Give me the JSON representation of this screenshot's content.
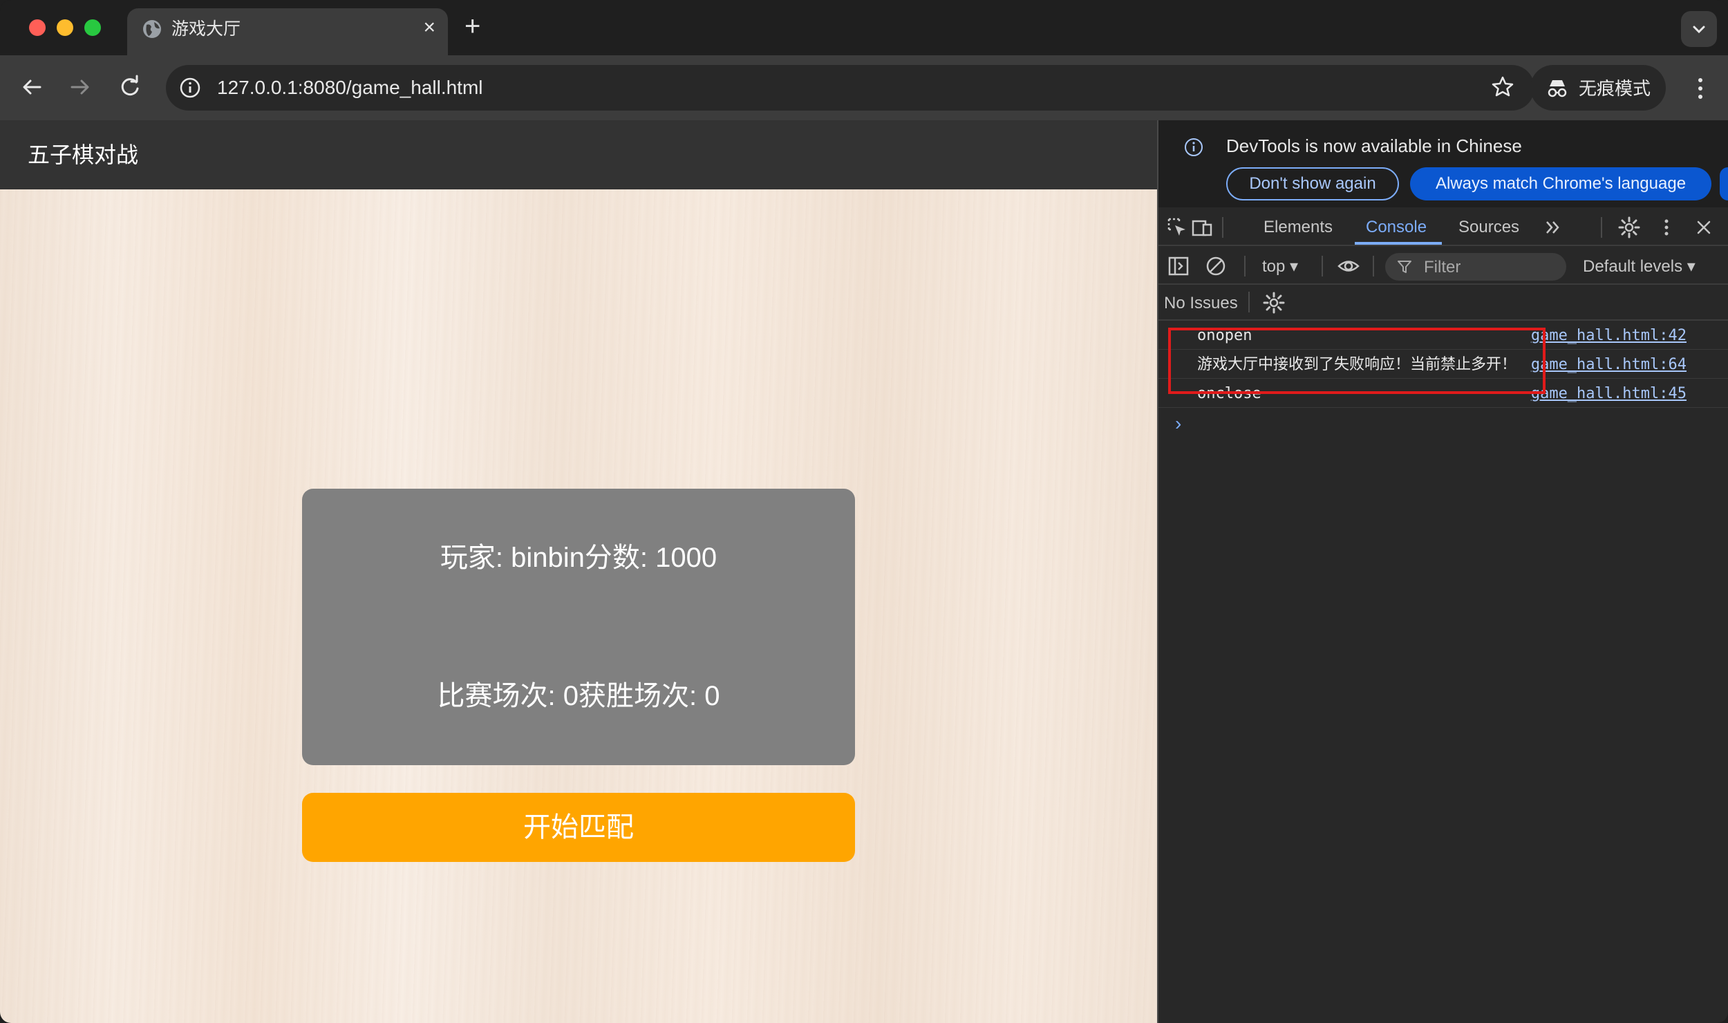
{
  "browser": {
    "tab_title": "游戏大厅",
    "tab_close": "×",
    "new_tab": "+",
    "url": "127.0.0.1:8080/game_hall.html",
    "incognito_label": "无痕模式"
  },
  "page": {
    "title": "五子棋对战",
    "player_line": "玩家: binbin分数: 1000",
    "stats_line": "比赛场次: 0获胜场次: 0",
    "match_button": "开始匹配"
  },
  "devtools": {
    "info_text": "DevTools is now available in Chinese",
    "btn_dont_show": "Don't show again",
    "btn_match_lang": "Always match Chrome's language",
    "tabs": [
      "Elements",
      "Console",
      "Sources"
    ],
    "active_tab": "Console",
    "context": "top",
    "filter_placeholder": "Filter",
    "levels": "Default levels",
    "issues": "No Issues",
    "logs": [
      {
        "message": "onopen",
        "source": "game_hall.html:42"
      },
      {
        "message": "游戏大厅中接收到了失败响应！当前禁止多开！",
        "source": "game_hall.html:64"
      },
      {
        "message": "onclose",
        "source": "game_hall.html:45"
      }
    ],
    "prompt": "›"
  },
  "colors": {
    "match_button": "#ffa500",
    "card": "#808080",
    "highlight": "#e01b1b",
    "accent": "#7cacf8"
  }
}
